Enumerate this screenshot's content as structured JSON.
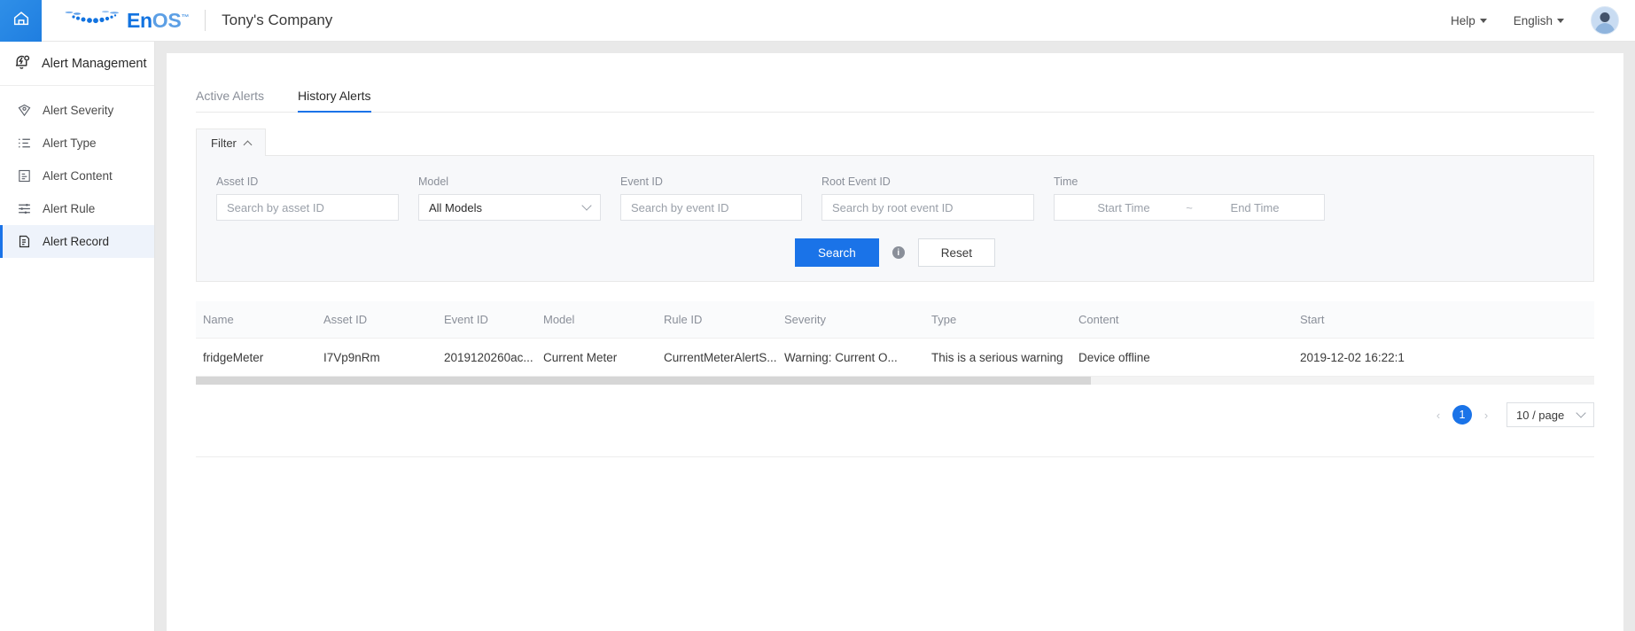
{
  "topbar": {
    "home_icon": "home-icon",
    "brand": {
      "en": "En",
      "os": "OS",
      "tm": "™"
    },
    "company": "Tony's Company",
    "help_label": "Help",
    "language_label": "English",
    "avatar": "user-avatar"
  },
  "sidebar": {
    "header": {
      "label": "Alert Management",
      "icon": "alert-bell-icon"
    },
    "items": [
      {
        "label": "Alert Severity",
        "icon": "severity-shield-icon",
        "active": false
      },
      {
        "label": "Alert Type",
        "icon": "list-icon",
        "active": false
      },
      {
        "label": "Alert Content",
        "icon": "document-icon",
        "active": false
      },
      {
        "label": "Alert Rule",
        "icon": "sliders-icon",
        "active": false
      },
      {
        "label": "Alert Record",
        "icon": "record-file-icon",
        "active": true
      }
    ]
  },
  "tabs": [
    {
      "label": "Active Alerts",
      "active": false
    },
    {
      "label": "History Alerts",
      "active": true
    }
  ],
  "filter": {
    "tab_label": "Filter",
    "collapse_icon": "chevron-up-icon",
    "fields": {
      "asset_id": {
        "label": "Asset ID",
        "placeholder": "Search by asset ID",
        "value": ""
      },
      "model": {
        "label": "Model",
        "value": "All Models",
        "icon": "chevron-down-icon"
      },
      "event_id": {
        "label": "Event ID",
        "placeholder": "Search by event ID",
        "value": ""
      },
      "root_event_id": {
        "label": "Root Event ID",
        "placeholder": "Search by root event ID",
        "value": ""
      },
      "time": {
        "label": "Time",
        "start_placeholder": "Start Time",
        "separator": "~",
        "end_placeholder": "End Time"
      }
    },
    "search_label": "Search",
    "info_icon": "info-icon",
    "info_glyph": "i",
    "reset_label": "Reset"
  },
  "table": {
    "columns": [
      "Name",
      "Asset ID",
      "Event ID",
      "Model",
      "Rule ID",
      "Severity",
      "Type",
      "Content",
      "Start"
    ],
    "rows": [
      {
        "name": "fridgeMeter",
        "asset_id": "I7Vp9nRm",
        "event_id": "2019120260ac...",
        "model": "Current Meter",
        "rule_id": "CurrentMeterAlertS...",
        "severity": "Warning: Current O...",
        "type": "This is a serious warning",
        "content": "Device offline",
        "start": "2019-12-02 16:22:1"
      }
    ]
  },
  "pagination": {
    "prev_icon": "chevron-left-icon",
    "prev_glyph": "‹",
    "current_page": "1",
    "next_icon": "chevron-right-icon",
    "next_glyph": "›",
    "page_size": "10 / page",
    "page_size_icon": "chevron-down-icon"
  },
  "colors": {
    "accent": "#1a73e8",
    "sidebar_active_bg": "#eef3fb",
    "panel_bg": "#f7f8fa",
    "muted_text": "#8a8f99"
  }
}
